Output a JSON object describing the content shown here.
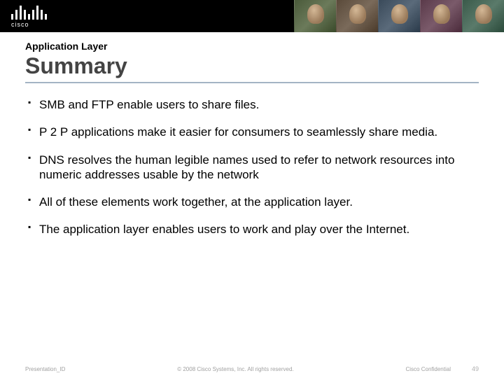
{
  "logo_text": "cisco",
  "eyebrow": "Application Layer",
  "title": "Summary",
  "bullets": [
    "SMB and FTP enable users to share files.",
    "P 2 P applications make it easier for consumers to seamlessly share media.",
    "DNS resolves the human legible names used to refer to network resources into numeric addresses usable by the network",
    "All of these elements work together, at the application layer.",
    "The application layer enables users to work and play over the Internet."
  ],
  "footer": {
    "left": "Presentation_ID",
    "center": "© 2008 Cisco Systems, Inc. All rights reserved.",
    "right": "Cisco Confidential",
    "page": "49"
  }
}
